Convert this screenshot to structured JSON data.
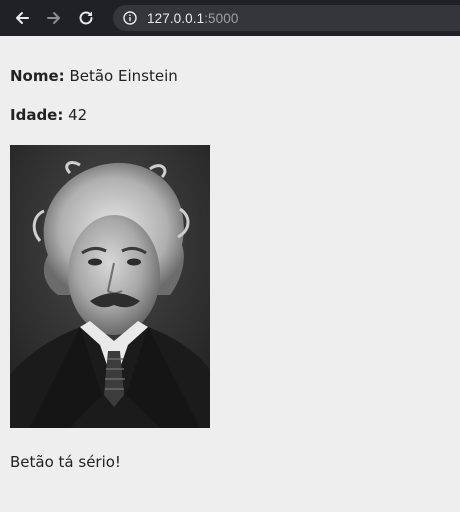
{
  "browser": {
    "url_host": "127.0.0.1",
    "url_port": ":5000"
  },
  "page": {
    "name_label": "Nome:",
    "name_value": "Betão Einstein",
    "age_label": "Idade:",
    "age_value": "42",
    "photo_subject": "portrait-photo",
    "caption": "Betão tá sério!"
  }
}
